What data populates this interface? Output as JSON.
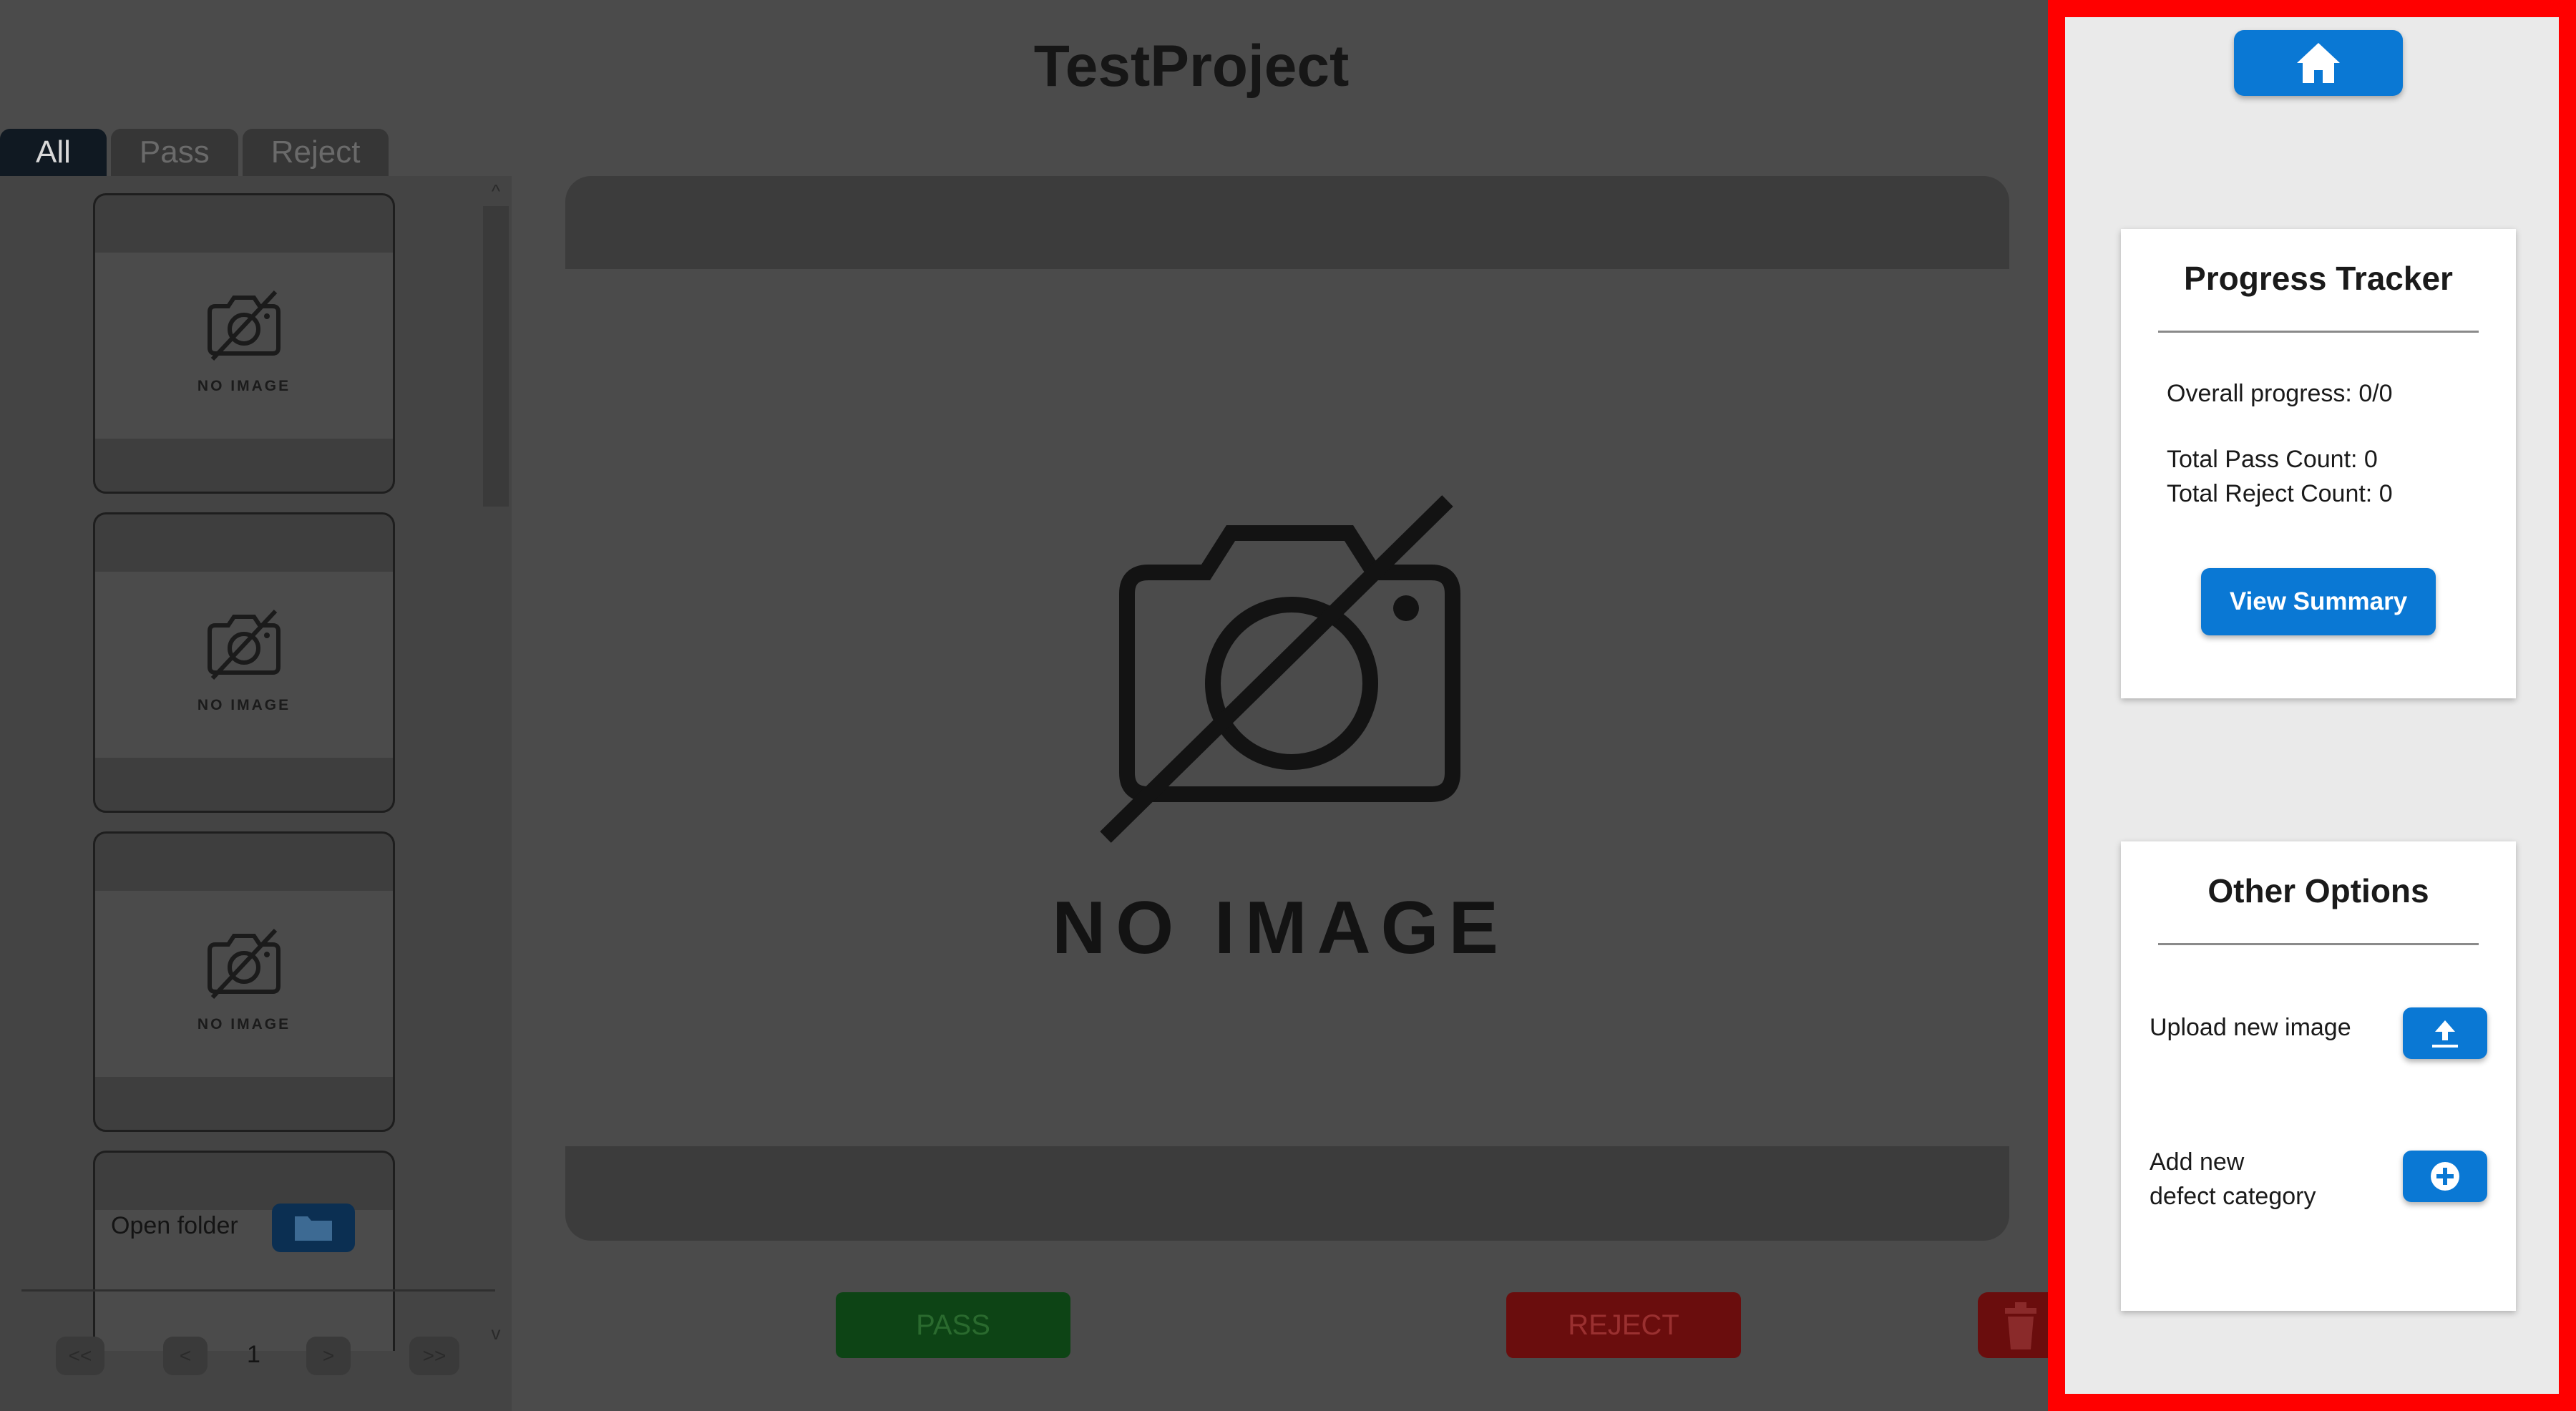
{
  "app": {
    "title": "TestProject"
  },
  "tabs": [
    {
      "label": "All",
      "active": true
    },
    {
      "label": "Pass",
      "active": false
    },
    {
      "label": "Reject",
      "active": false
    }
  ],
  "thumbnails": [
    {
      "placeholder_text": "NO IMAGE"
    },
    {
      "placeholder_text": "NO IMAGE"
    },
    {
      "placeholder_text": "NO IMAGE"
    }
  ],
  "sidebar": {
    "open_folder_label": "Open folder",
    "scroll_up": "^",
    "scroll_down": "v"
  },
  "pagination": {
    "first": "<<",
    "prev": "<",
    "page": "1",
    "next": ">",
    "last": ">>"
  },
  "viewer": {
    "placeholder_text": "NO IMAGE"
  },
  "actions": {
    "pass_label": "PASS",
    "reject_label": "REJECT"
  },
  "progress_tracker": {
    "title": "Progress Tracker",
    "overall_progress": "Overall progress: 0/0",
    "total_pass": "Total Pass Count: 0",
    "total_reject": "Total Reject Count: 0",
    "view_summary_label": "View Summary"
  },
  "other_options": {
    "title": "Other Options",
    "upload_label": "Upload new image",
    "add_category_line1": "Add new",
    "add_category_line2": "defect category"
  },
  "colors": {
    "accent": "#0a78d4",
    "highlight_frame": "#ff0000",
    "pass": "#0d4415",
    "reject": "#6a0d0d"
  }
}
